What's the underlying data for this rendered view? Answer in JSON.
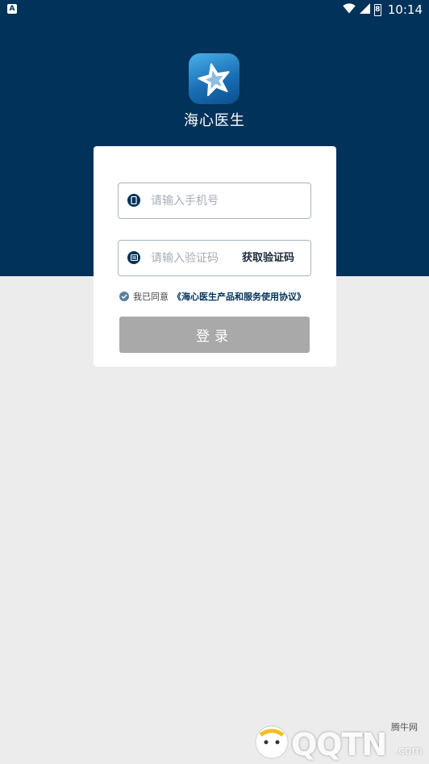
{
  "status_bar": {
    "left_icon_letter": "A",
    "time": "10:14",
    "battery_level": "8",
    "icons": [
      "wifi-icon",
      "signal-icon",
      "battery-icon"
    ]
  },
  "app": {
    "name": "海心医生",
    "logo_icon": "star-logo-icon"
  },
  "login": {
    "phone_placeholder": "请输入手机号",
    "code_placeholder": "请输入验证码",
    "get_code_label": "获取验证码",
    "agree_prefix": "我已同意",
    "agree_link": "《海心医生产品和服务使用协议》",
    "agreed": true,
    "submit_label": "登录"
  },
  "watermark": {
    "brand": "QQTN",
    "sub": "腾牛网",
    "suffix": ".com"
  },
  "colors": {
    "header_bg": "#00325a",
    "page_bg": "#ececec",
    "button_disabled": "#a9a9a9",
    "input_border": "#a8b4c2"
  }
}
